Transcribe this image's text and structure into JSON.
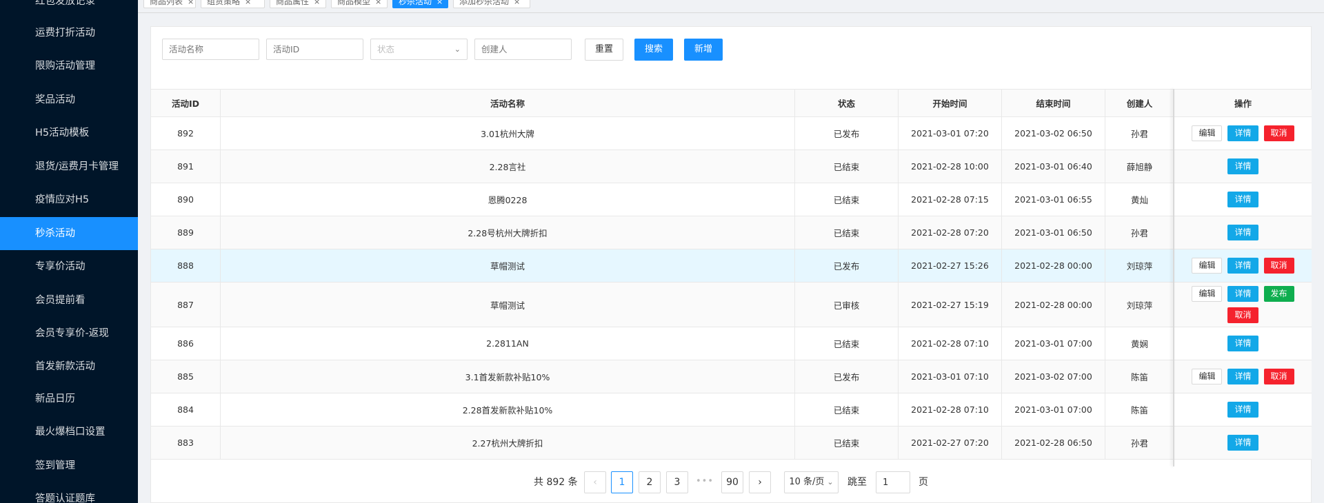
{
  "sidebar": {
    "items": [
      {
        "label": "红包发放记录"
      },
      {
        "label": "运费打折活动"
      },
      {
        "label": "限购活动管理"
      },
      {
        "label": "奖品活动"
      },
      {
        "label": "H5活动模板"
      },
      {
        "label": "退货/运费月卡管理"
      },
      {
        "label": "疫情应对H5"
      },
      {
        "label": "秒杀活动"
      },
      {
        "label": "专享价活动"
      },
      {
        "label": "会员提前看"
      },
      {
        "label": "会员专享价-返现"
      },
      {
        "label": "首发新款活动"
      },
      {
        "label": "新品日历"
      },
      {
        "label": "最火爆档口设置"
      },
      {
        "label": "签到管理"
      },
      {
        "label": "答题认证题库"
      }
    ],
    "active_index": 7
  },
  "tabs": [
    {
      "label": "商品列表"
    },
    {
      "label": "组货策略"
    },
    {
      "label": "商品属性"
    },
    {
      "label": "商品模型"
    },
    {
      "label": "秒杀活动"
    },
    {
      "label": "添加秒杀活动"
    }
  ],
  "filters": {
    "name_placeholder": "活动名称",
    "id_placeholder": "活动ID",
    "status_placeholder": "状态",
    "creator_placeholder": "创建人",
    "reset_label": "重置",
    "search_label": "搜索",
    "add_label": "新增"
  },
  "table": {
    "headers": {
      "id": "活动ID",
      "name": "活动名称",
      "status": "状态",
      "start": "开始时间",
      "end": "结束时间",
      "creator": "创建人",
      "ops": "操作"
    },
    "op_labels": {
      "edit": "编辑",
      "detail": "详情",
      "cancel": "取消",
      "publish": "发布"
    },
    "rows": [
      {
        "id": "892",
        "name": "3.01杭州大牌",
        "status": "已发布",
        "start": "2021-03-01 07:20",
        "end": "2021-03-02 06:50",
        "creator": "孙君",
        "ops": [
          "edit",
          "detail",
          "cancel"
        ]
      },
      {
        "id": "891",
        "name": "2.28言社",
        "status": "已结束",
        "start": "2021-02-28 10:00",
        "end": "2021-03-01 06:40",
        "creator": "薛旭静",
        "ops": [
          "detail"
        ]
      },
      {
        "id": "890",
        "name": "恩腾0228",
        "status": "已结束",
        "start": "2021-02-28 07:15",
        "end": "2021-03-01 06:55",
        "creator": "黄灿",
        "ops": [
          "detail"
        ]
      },
      {
        "id": "889",
        "name": "2.28号杭州大牌折扣",
        "status": "已结束",
        "start": "2021-02-28 07:20",
        "end": "2021-03-01 06:50",
        "creator": "孙君",
        "ops": [
          "detail"
        ]
      },
      {
        "id": "888",
        "name": "草帽测试",
        "status": "已发布",
        "start": "2021-02-27 15:26",
        "end": "2021-02-28 00:00",
        "creator": "刘琼萍",
        "ops": [
          "edit",
          "detail",
          "cancel"
        ]
      },
      {
        "id": "887",
        "name": "草帽测试",
        "status": "已审核",
        "start": "2021-02-27 15:19",
        "end": "2021-02-28 00:00",
        "creator": "刘琼萍",
        "ops": [
          "edit",
          "detail",
          "publish",
          "cancel"
        ]
      },
      {
        "id": "886",
        "name": "2.2811AN",
        "status": "已结束",
        "start": "2021-02-28 07:10",
        "end": "2021-03-01 07:00",
        "creator": "黄娴",
        "ops": [
          "detail"
        ]
      },
      {
        "id": "885",
        "name": "3.1首发新款补贴10%",
        "status": "已发布",
        "start": "2021-03-01 07:10",
        "end": "2021-03-02 07:00",
        "creator": "陈笛",
        "ops": [
          "edit",
          "detail",
          "cancel"
        ]
      },
      {
        "id": "884",
        "name": "2.28首发新款补贴10%",
        "status": "已结束",
        "start": "2021-02-28 07:10",
        "end": "2021-03-01 07:00",
        "creator": "陈笛",
        "ops": [
          "detail"
        ]
      },
      {
        "id": "883",
        "name": "2.27杭州大牌折扣",
        "status": "已结束",
        "start": "2021-02-27 07:20",
        "end": "2021-02-28 06:50",
        "creator": "孙君",
        "ops": [
          "detail"
        ]
      }
    ]
  },
  "pagination": {
    "total_text": "共 892 条",
    "pages": [
      "1",
      "2",
      "3",
      "90"
    ],
    "current": "1",
    "ellipsis": "•••",
    "prev": "‹",
    "next": "›",
    "page_size": "10 条/页",
    "jump_label": "跳至",
    "jump_value": "1",
    "page_suffix": "页"
  },
  "colors": {
    "sidebar_bg": "#001529",
    "primary": "#1890ff",
    "detail": "#13a8e8",
    "danger": "#f5222d",
    "success": "#0fae4f"
  }
}
